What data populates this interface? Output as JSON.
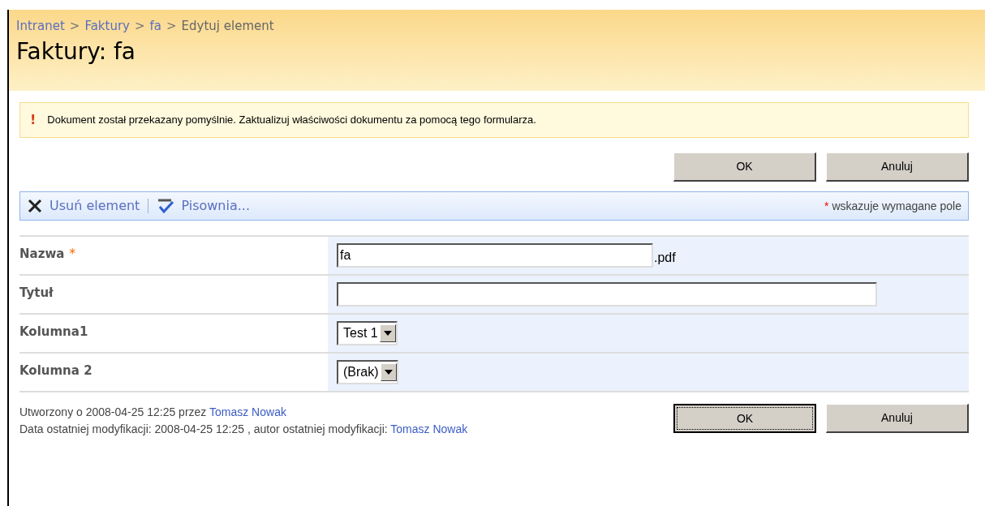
{
  "breadcrumb": [
    {
      "kind": "link",
      "text": "Intranet"
    },
    {
      "kind": "separator",
      "text": ">"
    },
    {
      "kind": "link",
      "text": "Faktury"
    },
    {
      "kind": "separator",
      "text": ">"
    },
    {
      "kind": "link",
      "text": "fa"
    },
    {
      "kind": "separator",
      "text": ">"
    },
    {
      "kind": "current",
      "text": "Edytuj element"
    }
  ],
  "title": "Faktury: fa",
  "message": {
    "icon": "!",
    "text": "Dokument został przekazany pomyślnie. Zaktualizuj właściwości dokumentu za pomocą tego formularza."
  },
  "top_buttons": [
    {
      "label": "OK",
      "focused": false
    },
    {
      "label": "Anuluj",
      "focused": false
    }
  ],
  "toolbar": {
    "items": [
      {
        "kind": "delete",
        "label": "Usuń element"
      },
      {
        "kind": "spelling",
        "label": "Pisownia..."
      }
    ],
    "required_mark": "*",
    "required_note": "wskazuje wymagane pole"
  },
  "fields": [
    {
      "label": "Nazwa",
      "required": true,
      "kind": "short_text",
      "value": "fa",
      "suffix": ".pdf"
    },
    {
      "label": "Tytuł",
      "required": false,
      "kind": "long_text"
    },
    {
      "label": "Kolumna1",
      "required": false,
      "kind": "select",
      "value": "Test 1"
    },
    {
      "label": "Kolumna 2",
      "required": false,
      "kind": "select",
      "value": "(Brak)"
    }
  ],
  "footer": {
    "created": {
      "text": "Utworzony o 2008-04-25 12:25  przez ",
      "author": "Tomasz Nowak"
    },
    "modified": {
      "text": "Data ostatniej modyfikacji: 2008-04-25 12:25 , autor ostatniej modyfikacji: ",
      "author": "Tomasz Nowak"
    }
  },
  "bottom_buttons": [
    {
      "label": "OK",
      "focused": true
    },
    {
      "label": "Anuluj",
      "focused": false
    }
  ]
}
